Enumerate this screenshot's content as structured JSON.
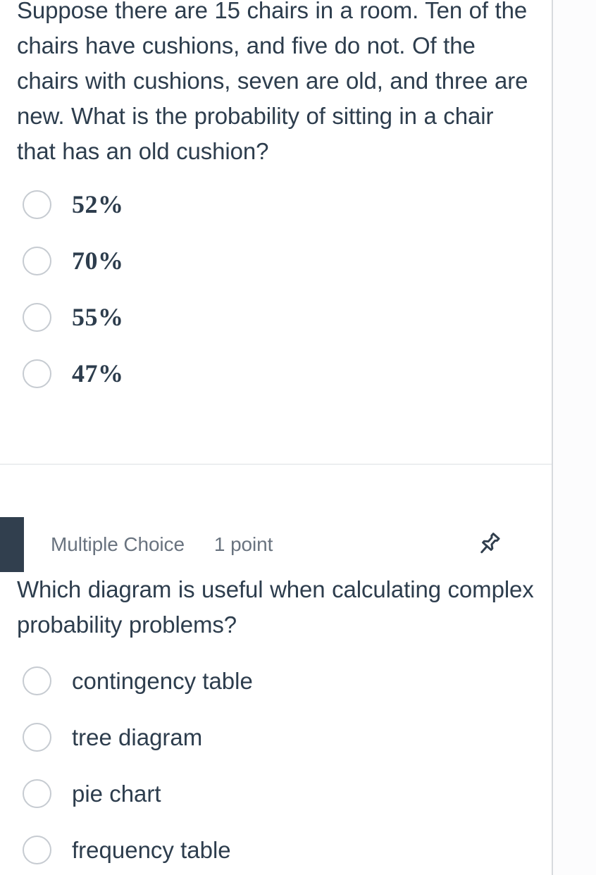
{
  "page": {
    "background_color": "#ffffff",
    "text_color": "#2d3d4d",
    "muted_text_color": "#69737f",
    "accent_color": "#313f4e",
    "radio_border_color": "#c6cbd1",
    "divider_color": "#eceef0",
    "rule_color": "#d7dade"
  },
  "questions": [
    {
      "prompt": "Suppose there are 15 chairs in a room. Ten of the chairs have cushions, and five do not. Of the chairs with cushions, seven are old, and three are new. What is the probability of sitting in a chair that has an old cushion?",
      "options": [
        {
          "label": "52%"
        },
        {
          "label": "70%"
        },
        {
          "label": "55%"
        },
        {
          "label": "47%"
        }
      ]
    },
    {
      "meta": {
        "type": "Multiple Choice",
        "points": "1 point",
        "pin_icon": "pushpin-icon"
      },
      "prompt": "Which diagram is useful when calculating complex probability problems?",
      "options": [
        {
          "label": "contingency table"
        },
        {
          "label": "tree diagram"
        },
        {
          "label": "pie chart"
        },
        {
          "label": "frequency table"
        }
      ]
    }
  ]
}
